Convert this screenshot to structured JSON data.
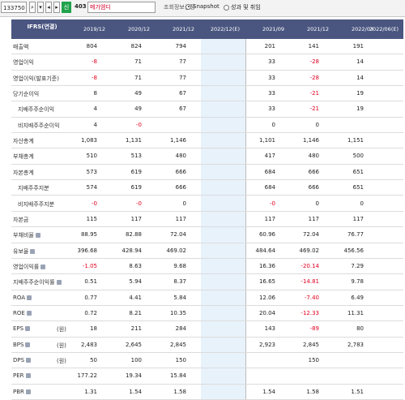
{
  "toolbar": {
    "code": "133750",
    "number": "403",
    "company": "메가엠디",
    "config_label": "조회정보설정",
    "snapshot_label": "Snapshot",
    "search_label": "성과 및 취임",
    "green_label": "신"
  },
  "table": {
    "title": "IFRS(연결)",
    "columns": [
      "2019/12",
      "2020/12",
      "2021/12",
      "2022/12(E)",
      "2021/09",
      "2021/12",
      "2022/03",
      "2022/06(E)"
    ],
    "rows": [
      {
        "label": "매출액",
        "sub": false,
        "icon": false,
        "unit": "",
        "values": [
          "804",
          "824",
          "794",
          "",
          "201",
          "141",
          "191",
          ""
        ]
      },
      {
        "label": "영업이익",
        "sub": false,
        "icon": false,
        "unit": "",
        "values": [
          "-8",
          "71",
          "77",
          "",
          "33",
          "-28",
          "14",
          ""
        ]
      },
      {
        "label": "영업이익(발표기준)",
        "sub": false,
        "icon": false,
        "unit": "",
        "values": [
          "-8",
          "71",
          "77",
          "",
          "33",
          "-28",
          "14",
          ""
        ]
      },
      {
        "label": "당기순이익",
        "sub": false,
        "icon": false,
        "unit": "",
        "values": [
          "8",
          "49",
          "67",
          "",
          "33",
          "-21",
          "19",
          ""
        ]
      },
      {
        "label": "지배주주순이익",
        "sub": true,
        "icon": false,
        "unit": "",
        "values": [
          "4",
          "49",
          "67",
          "",
          "33",
          "-21",
          "19",
          ""
        ]
      },
      {
        "label": "비지배주주순이익",
        "sub": true,
        "icon": false,
        "unit": "",
        "values": [
          "4",
          "-0",
          "",
          "",
          "0",
          "0",
          "",
          ""
        ]
      },
      {
        "label": "자산총계",
        "sub": false,
        "icon": false,
        "unit": "",
        "values": [
          "1,083",
          "1,131",
          "1,146",
          "",
          "1,101",
          "1,146",
          "1,151",
          ""
        ]
      },
      {
        "label": "부채총계",
        "sub": false,
        "icon": false,
        "unit": "",
        "values": [
          "510",
          "513",
          "480",
          "",
          "417",
          "480",
          "500",
          ""
        ]
      },
      {
        "label": "자본총계",
        "sub": false,
        "icon": false,
        "unit": "",
        "values": [
          "573",
          "619",
          "666",
          "",
          "684",
          "666",
          "651",
          ""
        ]
      },
      {
        "label": "지배주주지분",
        "sub": true,
        "icon": false,
        "unit": "",
        "values": [
          "574",
          "619",
          "666",
          "",
          "684",
          "666",
          "651",
          ""
        ]
      },
      {
        "label": "비지배주주지분",
        "sub": true,
        "icon": false,
        "unit": "",
        "values": [
          "-0",
          "-0",
          "0",
          "",
          "-0",
          "0",
          "0",
          ""
        ]
      },
      {
        "label": "자본금",
        "sub": false,
        "icon": false,
        "unit": "",
        "values": [
          "115",
          "117",
          "117",
          "",
          "117",
          "117",
          "117",
          ""
        ]
      },
      {
        "label": "부채비율",
        "sub": false,
        "icon": true,
        "unit": "",
        "values": [
          "88.95",
          "82.88",
          "72.04",
          "",
          "60.96",
          "72.04",
          "76.77",
          ""
        ]
      },
      {
        "label": "유보율",
        "sub": false,
        "icon": true,
        "unit": "",
        "values": [
          "396.68",
          "428.94",
          "469.02",
          "",
          "484.64",
          "469.02",
          "456.56",
          ""
        ]
      },
      {
        "label": "영업이익률",
        "sub": false,
        "icon": true,
        "unit": "",
        "values": [
          "-1.05",
          "8.63",
          "9.68",
          "",
          "16.36",
          "-20.14",
          "7.29",
          ""
        ]
      },
      {
        "label": "지배주주순이익률",
        "sub": false,
        "icon": true,
        "unit": "",
        "values": [
          "0.51",
          "5.94",
          "8.37",
          "",
          "16.65",
          "-14.81",
          "9.78",
          ""
        ]
      },
      {
        "label": "ROA",
        "sub": false,
        "icon": true,
        "unit": "",
        "values": [
          "0.77",
          "4.41",
          "5.84",
          "",
          "12.06",
          "-7.40",
          "6.49",
          ""
        ]
      },
      {
        "label": "ROE",
        "sub": false,
        "icon": true,
        "unit": "",
        "values": [
          "0.72",
          "8.21",
          "10.35",
          "",
          "20.04",
          "-12.33",
          "11.31",
          ""
        ]
      },
      {
        "label": "EPS",
        "sub": false,
        "icon": true,
        "unit": "(원)",
        "values": [
          "18",
          "211",
          "284",
          "",
          "143",
          "-89",
          "80",
          ""
        ]
      },
      {
        "label": "BPS",
        "sub": false,
        "icon": true,
        "unit": "(원)",
        "values": [
          "2,483",
          "2,645",
          "2,845",
          "",
          "2,923",
          "2,845",
          "2,783",
          ""
        ]
      },
      {
        "label": "DPS",
        "sub": false,
        "icon": true,
        "unit": "(원)",
        "values": [
          "50",
          "100",
          "150",
          "",
          "",
          "150",
          "",
          ""
        ]
      },
      {
        "label": "PER",
        "sub": false,
        "icon": true,
        "unit": "",
        "values": [
          "177.22",
          "19.34",
          "15.84",
          "",
          "",
          "",
          "",
          ""
        ]
      },
      {
        "label": "PBR",
        "sub": false,
        "icon": true,
        "unit": "",
        "values": [
          "1.31",
          "1.54",
          "1.58",
          "",
          "1.54",
          "1.58",
          "1.51",
          ""
        ]
      }
    ]
  },
  "colors": {
    "header_bg": "#4a5680",
    "negative": "#e0001f",
    "estimate_bg": "#e8f2fb",
    "brand_green": "#1fa24b"
  }
}
